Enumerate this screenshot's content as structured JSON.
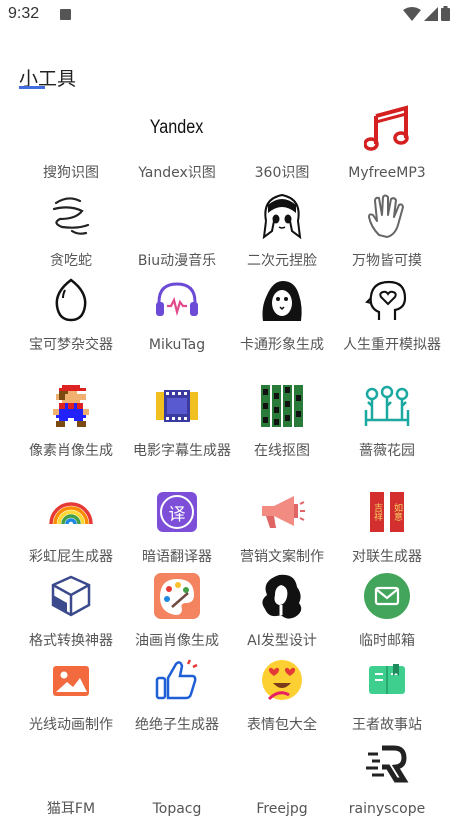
{
  "status_bar": {
    "time": "9:32",
    "icons": [
      "notification-a-icon",
      "wifi-icon",
      "signal-icon",
      "battery-icon"
    ]
  },
  "page": {
    "title": "小工具"
  },
  "tools": [
    {
      "label": "搜狗识图",
      "icon": "sogou-icon"
    },
    {
      "label": "Yandex识图",
      "icon": "yandex-logo",
      "logo_text": "Yandex"
    },
    {
      "label": "360识图",
      "icon": "360-icon"
    },
    {
      "label": "MyfreeMP3",
      "icon": "music-note-icon"
    },
    {
      "label": "贪吃蛇",
      "icon": "snake-icon"
    },
    {
      "label": "Biu动漫音乐",
      "icon": "anime-music-icon"
    },
    {
      "label": "二次元捏脸",
      "icon": "anime-face-icon"
    },
    {
      "label": "万物皆可摸",
      "icon": "hand-icon"
    },
    {
      "label": "宝可梦杂交器",
      "icon": "pokemon-egg-icon"
    },
    {
      "label": "MikuTag",
      "icon": "headphones-icon"
    },
    {
      "label": "卡通形象生成",
      "icon": "cartoon-ghost-icon"
    },
    {
      "label": "人生重开模拟器",
      "icon": "head-heart-icon"
    },
    {
      "label": "像素肖像生成",
      "icon": "pixel-mario-icon"
    },
    {
      "label": "电影字幕生成器",
      "icon": "film-strip-icon"
    },
    {
      "label": "在线抠图",
      "icon": "photo-strips-icon"
    },
    {
      "label": "蔷薇花园",
      "icon": "garden-icon"
    },
    {
      "label": "彩虹屁生成器",
      "icon": "rainbow-icon"
    },
    {
      "label": "暗语翻译器",
      "icon": "translate-icon",
      "glyph": "译"
    },
    {
      "label": "营销文案制作",
      "icon": "megaphone-icon"
    },
    {
      "label": "对联生成器",
      "icon": "couplet-icon",
      "glyph_a": "吉祥",
      "glyph_b": "如意"
    },
    {
      "label": "格式转换神器",
      "icon": "cube-convert-icon"
    },
    {
      "label": "油画肖像生成",
      "icon": "palette-icon"
    },
    {
      "label": "AI发型设计",
      "icon": "hairstyle-icon"
    },
    {
      "label": "临时邮箱",
      "icon": "mail-icon"
    },
    {
      "label": "光线动画制作",
      "icon": "image-icon"
    },
    {
      "label": "绝绝子生成器",
      "icon": "thumbs-up-icon"
    },
    {
      "label": "表情包大全",
      "icon": "emoji-icon"
    },
    {
      "label": "王者故事站",
      "icon": "book-icon"
    },
    {
      "label": "猫耳FM",
      "icon": "none"
    },
    {
      "label": "Topacg",
      "icon": "none"
    },
    {
      "label": "Freejpg",
      "icon": "none"
    },
    {
      "label": "rainyscope",
      "icon": "rainyscope-icon"
    }
  ]
}
